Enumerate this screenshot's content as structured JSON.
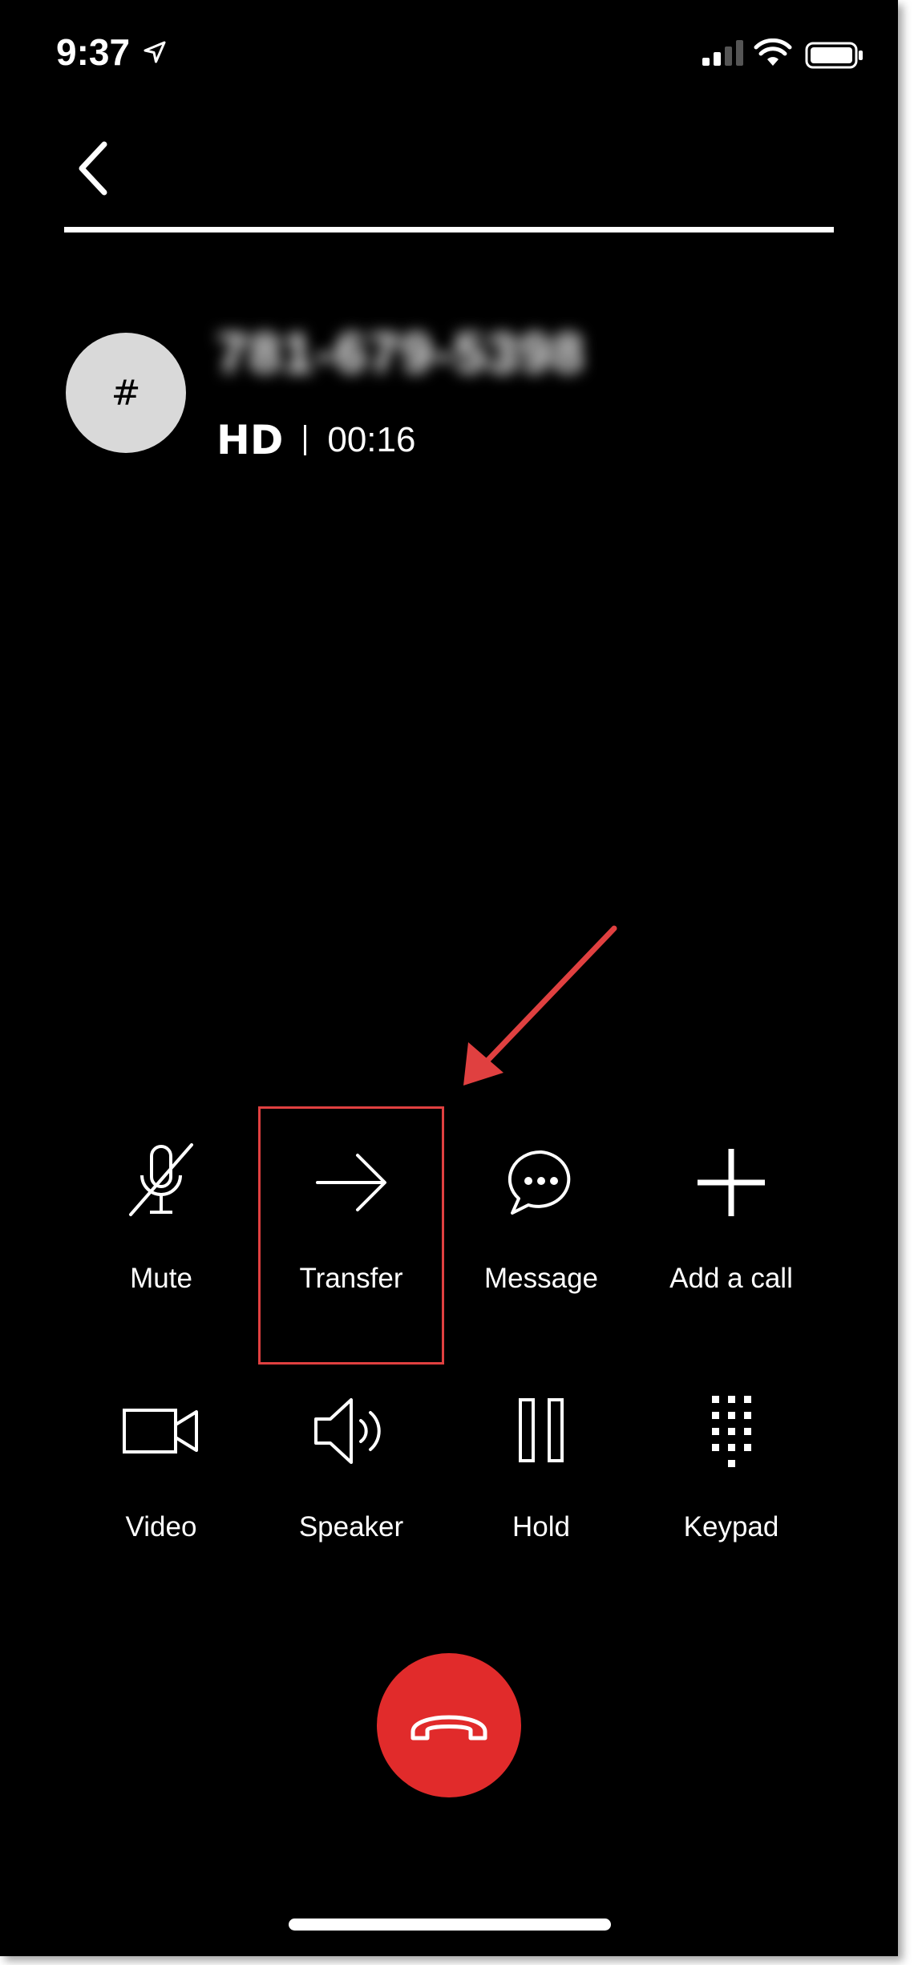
{
  "status_bar": {
    "time": "9:37",
    "icons": [
      "location-arrow-icon",
      "signal-icon",
      "wifi-icon",
      "battery-icon"
    ]
  },
  "header": {
    "back_icon": "chevron-left-icon"
  },
  "caller": {
    "avatar_text": "#",
    "number": "781-679-5398",
    "hd_label": "HD",
    "duration": "00:16"
  },
  "controls": [
    {
      "id": "mute",
      "label": "Mute",
      "icon": "microphone-muted-icon"
    },
    {
      "id": "transfer",
      "label": "Transfer",
      "icon": "arrow-right-icon"
    },
    {
      "id": "message",
      "label": "Message",
      "icon": "chat-bubble-icon"
    },
    {
      "id": "add-call",
      "label": "Add a call",
      "icon": "plus-icon"
    },
    {
      "id": "video",
      "label": "Video",
      "icon": "video-camera-icon"
    },
    {
      "id": "speaker",
      "label": "Speaker",
      "icon": "speaker-icon"
    },
    {
      "id": "hold",
      "label": "Hold",
      "icon": "pause-icon"
    },
    {
      "id": "keypad",
      "label": "Keypad",
      "icon": "keypad-icon"
    }
  ],
  "end_call": {
    "icon": "hang-up-icon"
  },
  "colors": {
    "background": "#000000",
    "end_call": "#e12b2b",
    "annotation": "#e04040",
    "avatar": "#d9d9d9"
  }
}
